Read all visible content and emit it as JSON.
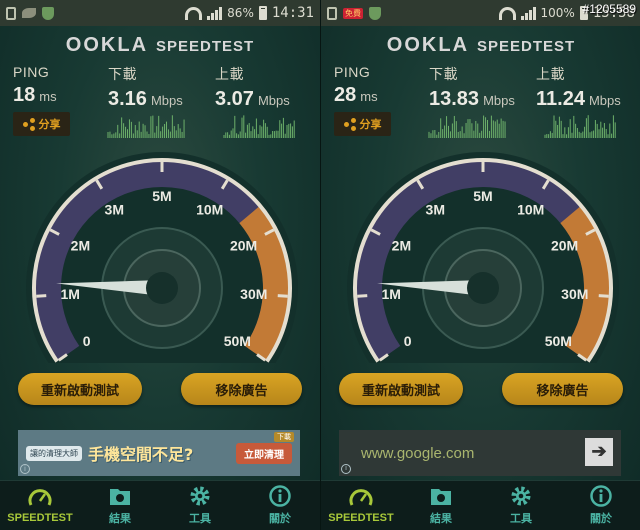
{
  "watermark": "#1205589",
  "panels": [
    {
      "status": {
        "battery": "86%",
        "time": "14:31",
        "promo": ""
      },
      "logo": {
        "brand": "OOKLA",
        "product": "SPEEDTEST"
      },
      "ping": {
        "label": "PING",
        "value": "18",
        "unit": "ms"
      },
      "download": {
        "label": "下載",
        "value": "3.16",
        "unit": "Mbps"
      },
      "upload": {
        "label": "上載",
        "value": "3.07",
        "unit": "Mbps"
      },
      "share_label": "分享",
      "gauge": {
        "ticks": [
          "0",
          "1M",
          "2M",
          "3M",
          "5M",
          "10M",
          "20M",
          "30M",
          "50M"
        ],
        "needle_value": 0.15
      },
      "buttons": {
        "restart": "重新啟動測試",
        "remove_ads": "移除廣告"
      },
      "ad": {
        "type": "cn",
        "bubble": "讓的清理大師",
        "headline": "手機空間不足?",
        "cta": "立即清理",
        "tag": "下載"
      },
      "nav": [
        "SPEEDTEST",
        "結果",
        "工具",
        "關於"
      ]
    },
    {
      "status": {
        "battery": "100%",
        "time": "15:58",
        "promo": "免費"
      },
      "logo": {
        "brand": "OOKLA",
        "product": "SPEEDTEST"
      },
      "ping": {
        "label": "PING",
        "value": "28",
        "unit": "ms"
      },
      "download": {
        "label": "下載",
        "value": "13.83",
        "unit": "Mbps"
      },
      "upload": {
        "label": "上載",
        "value": "11.24",
        "unit": "Mbps"
      },
      "share_label": "分享",
      "gauge": {
        "ticks": [
          "0",
          "1M",
          "2M",
          "3M",
          "5M",
          "10M",
          "20M",
          "30M",
          "50M"
        ],
        "needle_value": 0.15
      },
      "buttons": {
        "restart": "重新啟動測試",
        "remove_ads": "移除廣告"
      },
      "ad": {
        "type": "google",
        "url": "www.google.com"
      },
      "nav": [
        "SPEEDTEST",
        "結果",
        "工具",
        "關於"
      ]
    }
  ],
  "colors": {
    "accent": "#d9a423",
    "nav_active": "#a8c83a",
    "nav_text": "#4bb3a3",
    "gauge_hot": "#d9852e"
  }
}
